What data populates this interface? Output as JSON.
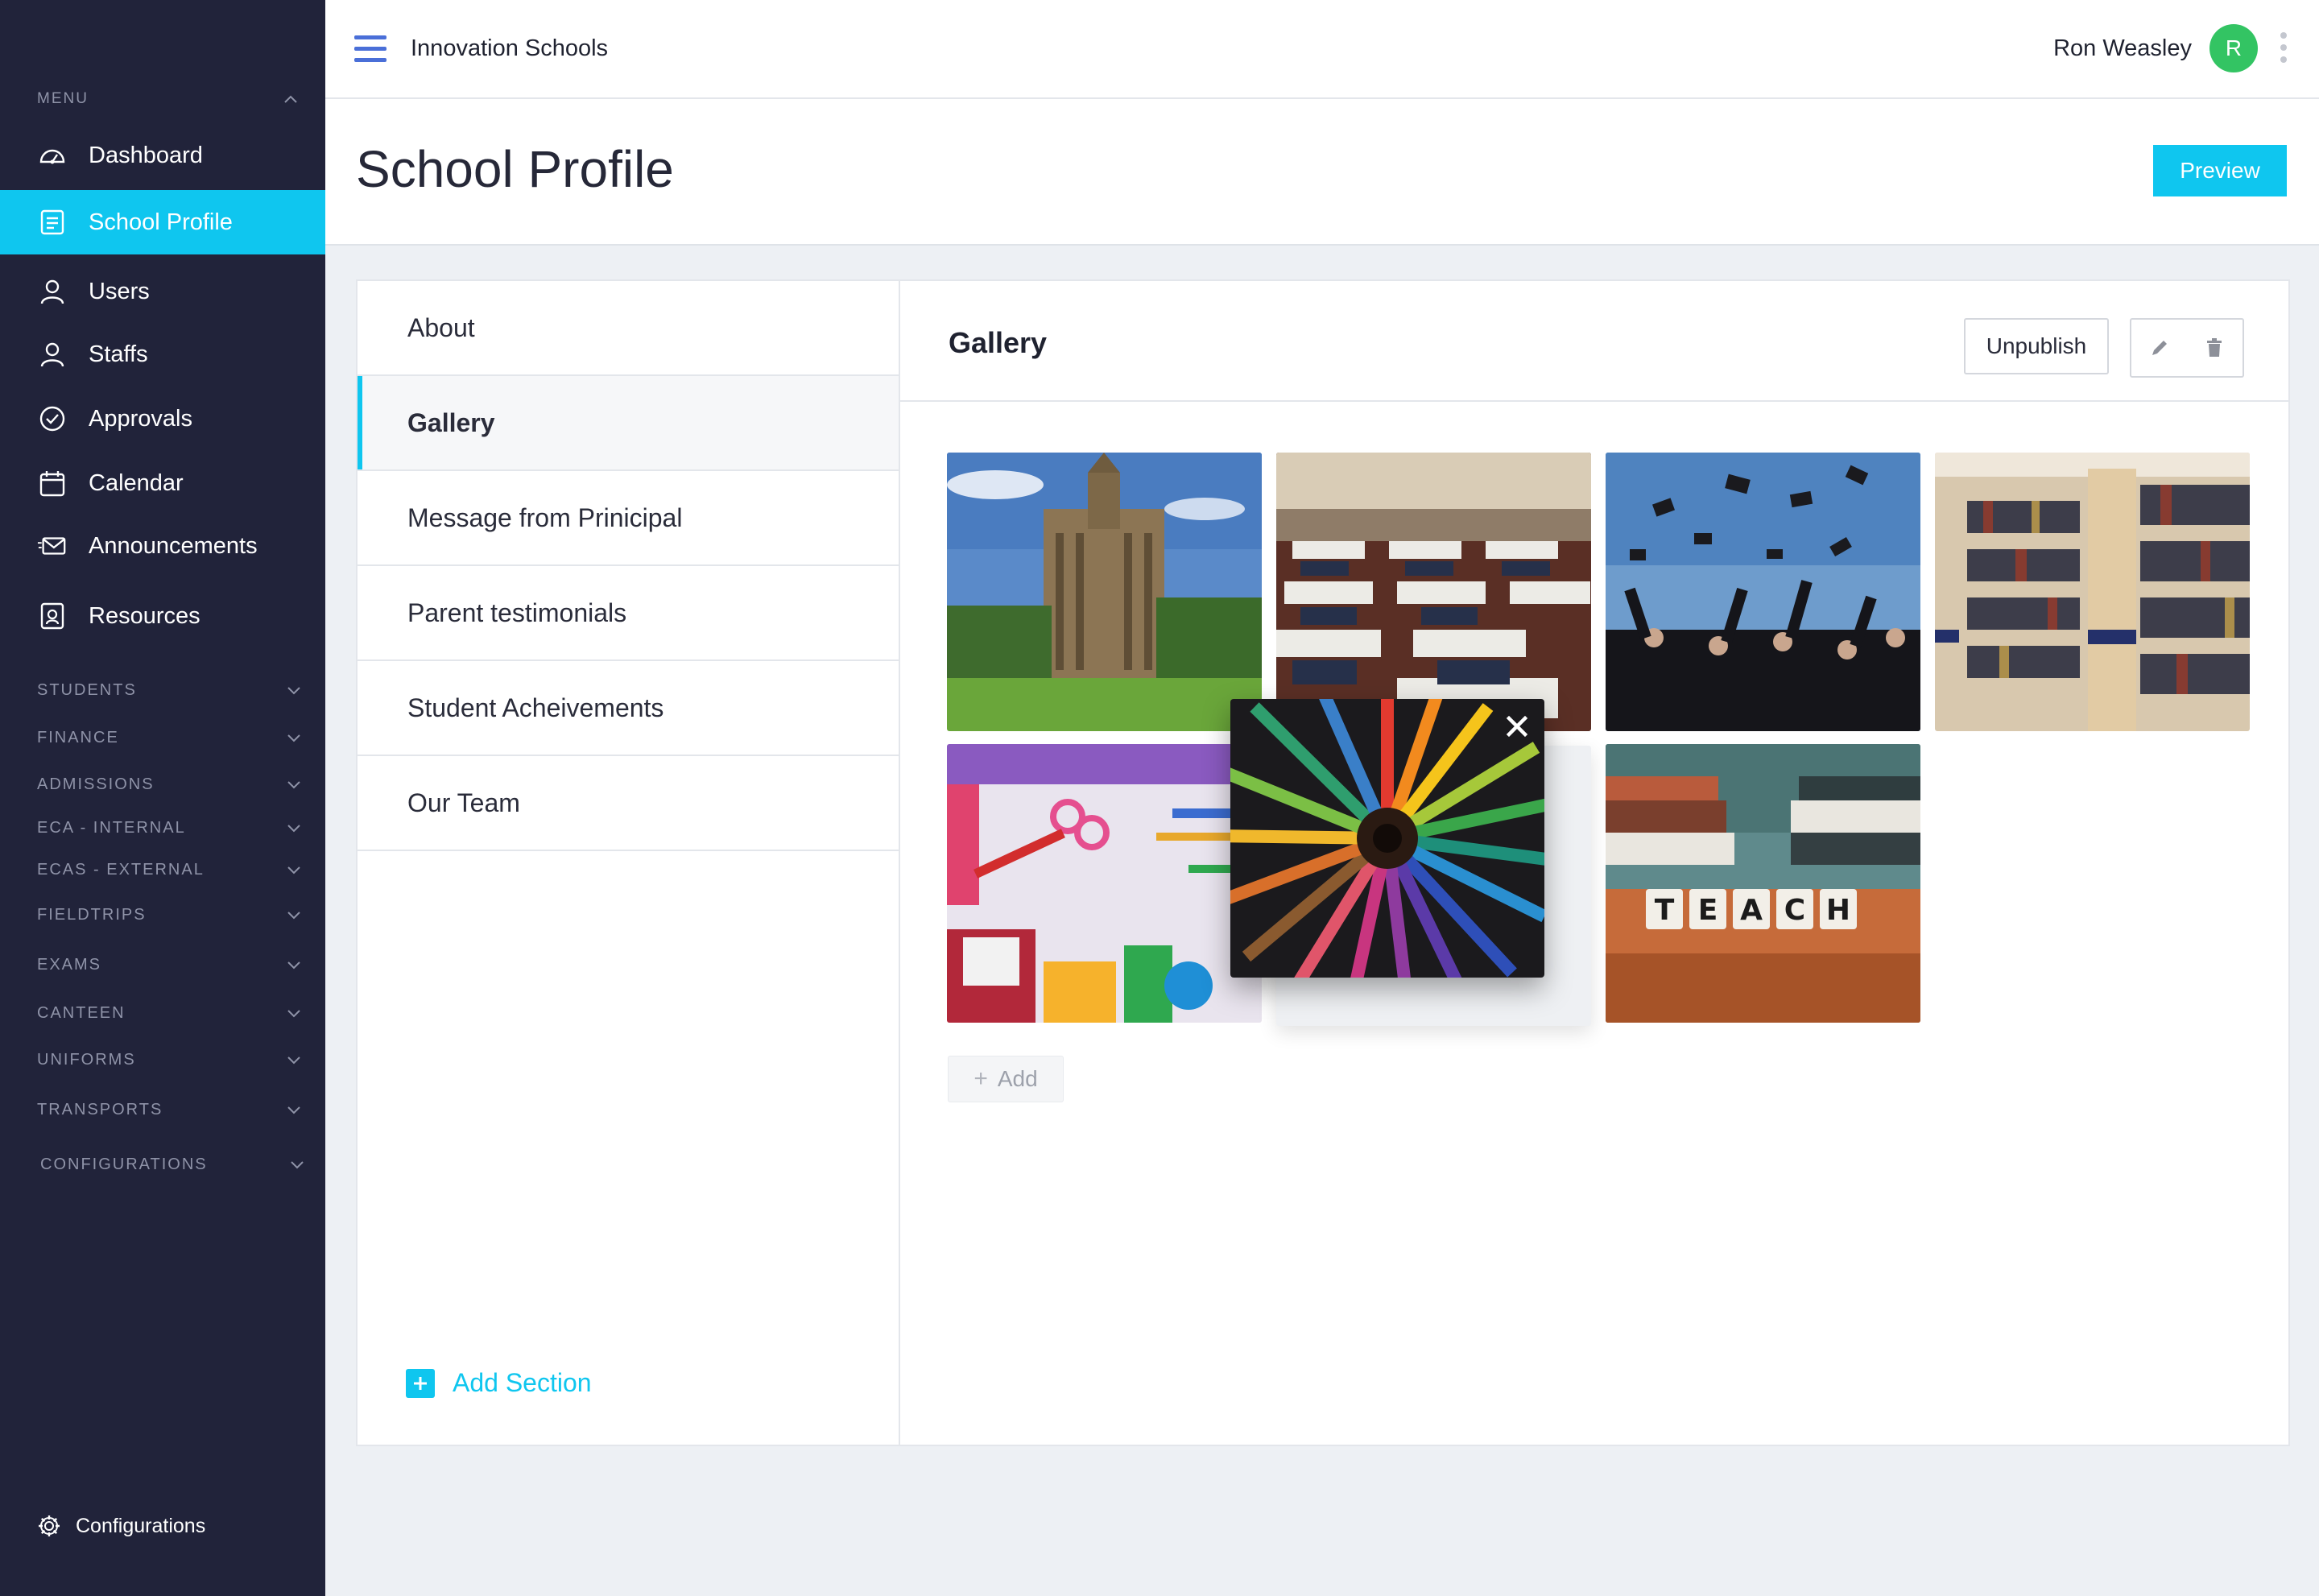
{
  "sidebar": {
    "menu_label": "MENU",
    "items": [
      {
        "label": "Dashboard",
        "icon": "dashboard-icon"
      },
      {
        "label": "School Profile",
        "icon": "profile-icon",
        "active": true
      },
      {
        "label": "Users",
        "icon": "user-icon"
      },
      {
        "label": "Staffs",
        "icon": "user-icon"
      },
      {
        "label": "Approvals",
        "icon": "check-circle-icon"
      },
      {
        "label": "Calendar",
        "icon": "calendar-icon"
      },
      {
        "label": "Announcements",
        "icon": "mail-icon"
      },
      {
        "label": "Resources",
        "icon": "resources-icon"
      }
    ],
    "groups": [
      "STUDENTS",
      "FINANCE",
      "ADMISSIONS",
      "ECA - INTERNAL",
      "ECAS - EXTERNAL",
      "FIELDTRIPS",
      "EXAMS",
      "CANTEEN",
      "UNIFORMS",
      "TRANSPORTS",
      "CONFIGURATIONS"
    ],
    "footer_label": "Configurations"
  },
  "header": {
    "org_name": "Innovation Schools",
    "user_name": "Ron Weasley",
    "avatar_initial": "R"
  },
  "page": {
    "title": "School Profile",
    "preview_label": "Preview"
  },
  "sections": {
    "items": [
      "About",
      "Gallery",
      "Message from Prinicipal",
      "Parent testimonials",
      "Student Acheivements",
      "Our Team"
    ],
    "active": "Gallery",
    "add_label": "Add Section"
  },
  "gallery": {
    "title": "Gallery",
    "unpublish_label": "Unpublish",
    "add_label": "Add",
    "images": [
      "university-building",
      "empty-classroom",
      "graduation-caps",
      "library-shelves",
      "school-supplies",
      "dragging-slot",
      "teach-blocks"
    ],
    "dragging_image": "colored-pencils"
  },
  "colors": {
    "sidebar_bg": "#21233a",
    "accent": "#0fc6ef",
    "avatar": "#33c463",
    "hamburger": "#4a6fd8"
  }
}
